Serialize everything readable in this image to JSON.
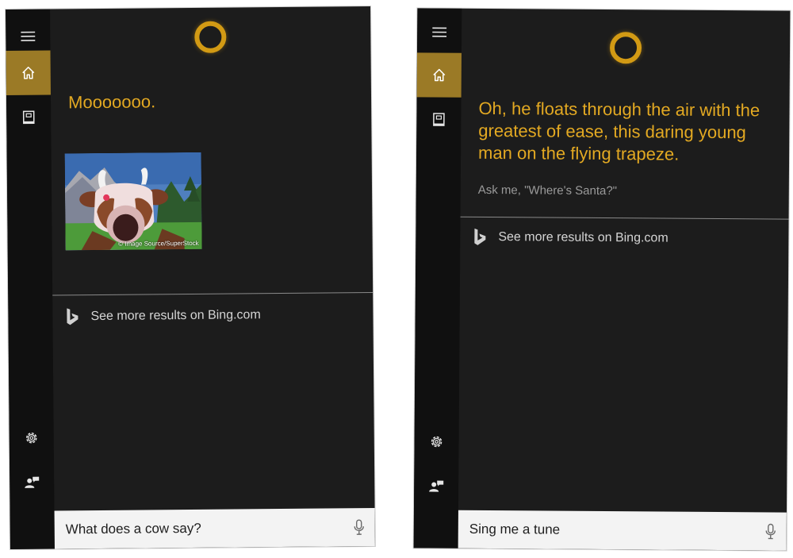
{
  "colors": {
    "accent": "#9b7a26",
    "cortana_gold": "#d29a14",
    "answer_text": "#e3a922",
    "panel_bg": "#1c1c1c",
    "sidebar_bg": "#101010",
    "search_bg": "#f3f3f3"
  },
  "icons": {
    "menu": "hamburger-icon",
    "home": "home-icon",
    "notebook": "notebook-icon",
    "settings": "gear-icon",
    "feedback": "feedback-icon",
    "bing": "bing-logo-icon",
    "mic": "microphone-icon",
    "cortana": "cortana-ring-icon"
  },
  "left_panel": {
    "answer": "Mooooooo.",
    "image": {
      "credit": "© Image Source/SuperStock"
    },
    "bing_link": "See more results on Bing.com",
    "search": {
      "value": "What does a cow say?"
    }
  },
  "right_panel": {
    "answer": "Oh, he floats through the air with the greatest of ease, this daring young man on the flying trapeze.",
    "hint": "Ask me, \"Where's Santa?\"",
    "bing_link": "See more results on Bing.com",
    "search": {
      "value": "Sing me a tune"
    }
  }
}
